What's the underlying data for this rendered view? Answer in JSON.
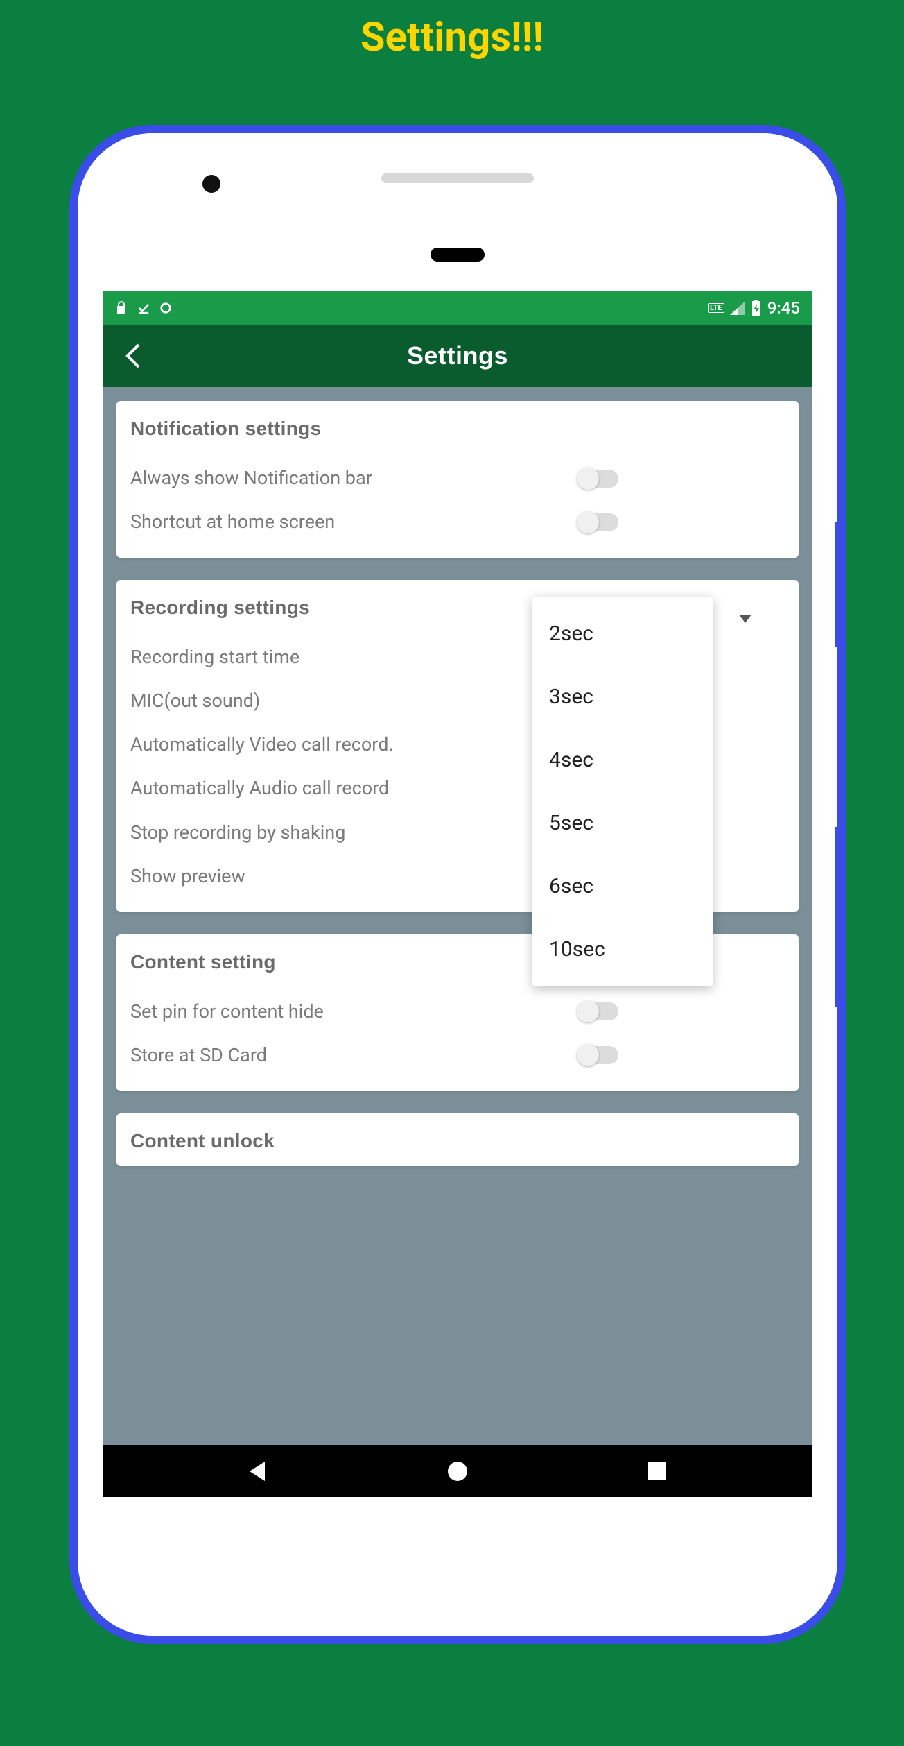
{
  "promo": {
    "title": "Settings!!!"
  },
  "statusbar": {
    "time": "9:45",
    "lte": "LTE"
  },
  "appbar": {
    "title": "Settings"
  },
  "sections": {
    "notification": {
      "title": "Notification settings",
      "items": [
        {
          "label": "Always show Notification bar"
        },
        {
          "label": "Shortcut at home screen"
        }
      ]
    },
    "recording": {
      "title": "Recording settings",
      "items": [
        {
          "label": "Recording start time"
        },
        {
          "label": "MIC(out sound)"
        },
        {
          "label": "Automatically Video call record."
        },
        {
          "label": "Automatically Audio call record"
        },
        {
          "label": "Stop recording by shaking"
        },
        {
          "label": "Show preview"
        }
      ]
    },
    "content_setting": {
      "title": "Content setting",
      "items": [
        {
          "label": "Set pin for content hide"
        },
        {
          "label": "Store at SD Card"
        }
      ]
    },
    "content_unlock": {
      "title": "Content unlock"
    }
  },
  "dropdown": {
    "options": [
      "2sec",
      "3sec",
      "4sec",
      "5sec",
      "6sec",
      "10sec"
    ]
  }
}
